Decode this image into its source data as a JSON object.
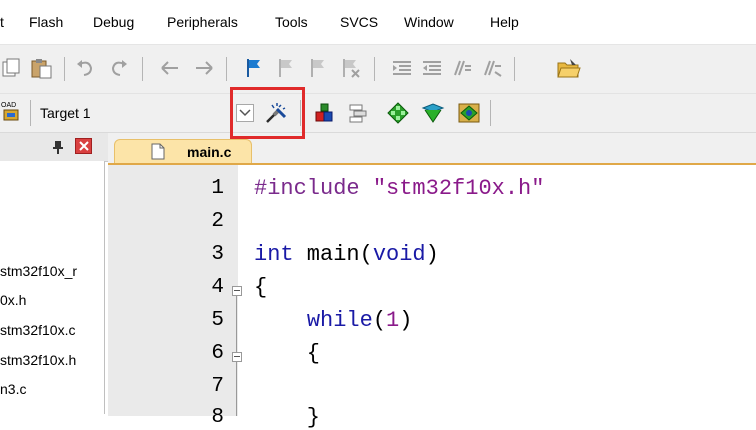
{
  "menu": [
    {
      "label": "t"
    },
    {
      "label": "Flash"
    },
    {
      "label": "Debug"
    },
    {
      "label": "Peripherals"
    },
    {
      "label": "Tools"
    },
    {
      "label": "SVCS"
    },
    {
      "label": "Window"
    },
    {
      "label": "Help"
    }
  ],
  "toolbar2": {
    "target_label": "Target 1",
    "load_icon_text": "OAD"
  },
  "project_panel": {
    "pin_icon": "pin-icon",
    "close_icon": "close-icon",
    "items": [
      "stm32f10x_r",
      "0x.h",
      "stm32f10x.c",
      "stm32f10x.h",
      "n3.c"
    ]
  },
  "editor": {
    "tab_label": "main.c",
    "line_numbers": [
      "1",
      "2",
      "3",
      "4",
      "5",
      "6",
      "7",
      "8"
    ],
    "lines": [
      {
        "pp": "#include ",
        "str": "\"stm32f10x.h\""
      },
      {},
      {
        "kw1": "int",
        "text": " main(",
        "kw2": "void",
        "text2": ")"
      },
      {
        "text": "{"
      },
      {
        "indent": "    ",
        "kw": "while",
        "text": "(",
        "num": "1",
        "text2": ")"
      },
      {
        "text": "    {"
      },
      {},
      {
        "text": "    }"
      }
    ]
  },
  "colors": {
    "highlight": "#e02a2a",
    "tab_active": "#fce4a8",
    "keyword": "#1a1aa6",
    "string": "#8a1a8a"
  }
}
